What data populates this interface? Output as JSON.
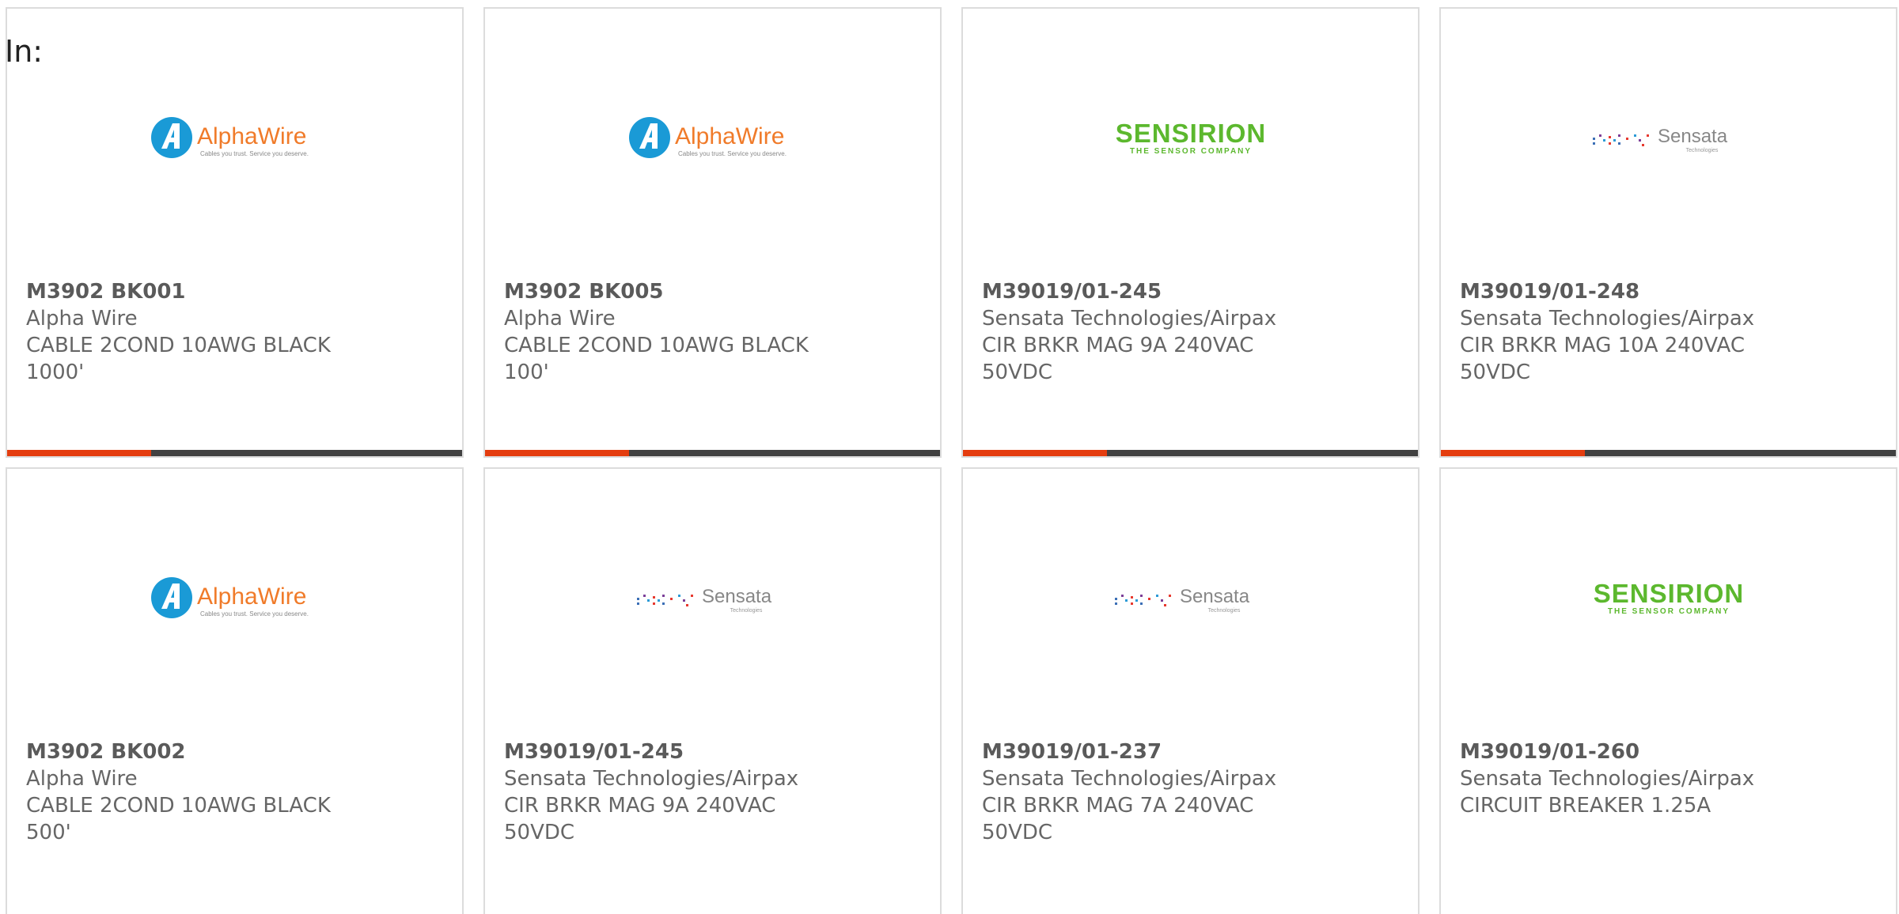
{
  "header": {
    "prefix": "In:"
  },
  "colors": {
    "accent": "#e43d0f",
    "bar": "#414141",
    "border": "#dcdcdc",
    "text": "#666666"
  },
  "logos": {
    "alphawire": {
      "name": "AlphaWire",
      "tagline": "Cables you trust. Service you deserve.",
      "mark_color": "#1a9ad6",
      "text_color": "#f07b2a"
    },
    "sensirion": {
      "name": "SENSIRION",
      "tagline": "THE SENSOR COMPANY",
      "color": "#5cb82e"
    },
    "sensata": {
      "name": "Sensata",
      "tagline": "Technologies",
      "color": "#888888"
    }
  },
  "cards": [
    {
      "logo": "alphawire",
      "part": "M3902 BK001",
      "maker": "Alpha Wire",
      "desc1": "CABLE 2COND 10AWG BLACK",
      "desc2": "1000'"
    },
    {
      "logo": "alphawire",
      "part": "M3902 BK005",
      "maker": "Alpha Wire",
      "desc1": "CABLE 2COND 10AWG BLACK",
      "desc2": "100'"
    },
    {
      "logo": "sensirion",
      "part": "M39019/01-245",
      "maker": "Sensata Technologies/Airpax",
      "desc1": "CIR BRKR MAG 9A 240VAC 50VDC",
      "desc2": ""
    },
    {
      "logo": "sensata",
      "part": "M39019/01-248",
      "maker": "Sensata Technologies/Airpax",
      "desc1": "CIR BRKR MAG 10A 240VAC",
      "desc2": "50VDC"
    },
    {
      "logo": "alphawire",
      "part": "M3902 BK002",
      "maker": "Alpha Wire",
      "desc1": "CABLE 2COND 10AWG BLACK",
      "desc2": "500'"
    },
    {
      "logo": "sensata",
      "part": "M39019/01-245",
      "maker": "Sensata Technologies/Airpax",
      "desc1": "CIR BRKR MAG 9A 240VAC 50VDC",
      "desc2": ""
    },
    {
      "logo": "sensata",
      "part": "M39019/01-237",
      "maker": "Sensata Technologies/Airpax",
      "desc1": "CIR BRKR MAG 7A 240VAC 50VDC",
      "desc2": ""
    },
    {
      "logo": "sensirion",
      "part": "M39019/01-260",
      "maker": "Sensata Technologies/Airpax",
      "desc1": "CIRCUIT BREAKER 1.25A",
      "desc2": ""
    }
  ]
}
